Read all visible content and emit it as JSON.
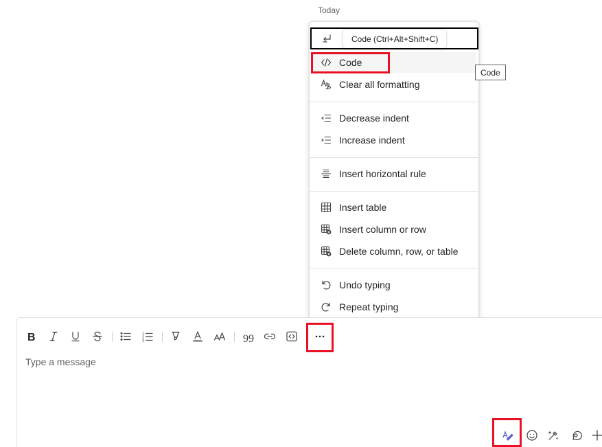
{
  "chat": {
    "date_label": "Today"
  },
  "menu": {
    "top_row_tooltip": "Code (Ctrl+Alt+Shift+C)",
    "side_tooltip": "Code",
    "items": [
      {
        "label": "Code",
        "icon": "code-icon"
      },
      {
        "label": "Clear all formatting",
        "icon": "clear-formatting-icon"
      },
      {
        "label": "Decrease indent",
        "icon": "decrease-indent-icon"
      },
      {
        "label": "Increase indent",
        "icon": "increase-indent-icon"
      },
      {
        "label": "Insert horizontal rule",
        "icon": "horizontal-rule-icon"
      },
      {
        "label": "Insert table",
        "icon": "table-icon"
      },
      {
        "label": "Insert column or row",
        "icon": "table-add-icon"
      },
      {
        "label": "Delete column, row, or table",
        "icon": "table-delete-icon"
      },
      {
        "label": "Undo typing",
        "icon": "undo-icon"
      },
      {
        "label": "Repeat typing",
        "icon": "redo-icon"
      }
    ]
  },
  "compose": {
    "placeholder": "Type a message",
    "toolbar": [
      "bold-icon",
      "italic-icon",
      "underline-icon",
      "strikethrough-icon",
      "bullet-list-icon",
      "numbered-list-icon",
      "highlight-icon",
      "font-color-icon",
      "font-size-icon",
      "quote-icon",
      "link-icon",
      "code-snippet-icon",
      "more-options-icon"
    ],
    "bottom_icons": [
      "format-icon",
      "emoji-icon",
      "copilot-icon",
      "loop-icon",
      "add-icon"
    ]
  },
  "colors": {
    "highlight_box": "#e81123",
    "accent": "#5b5fc7"
  }
}
